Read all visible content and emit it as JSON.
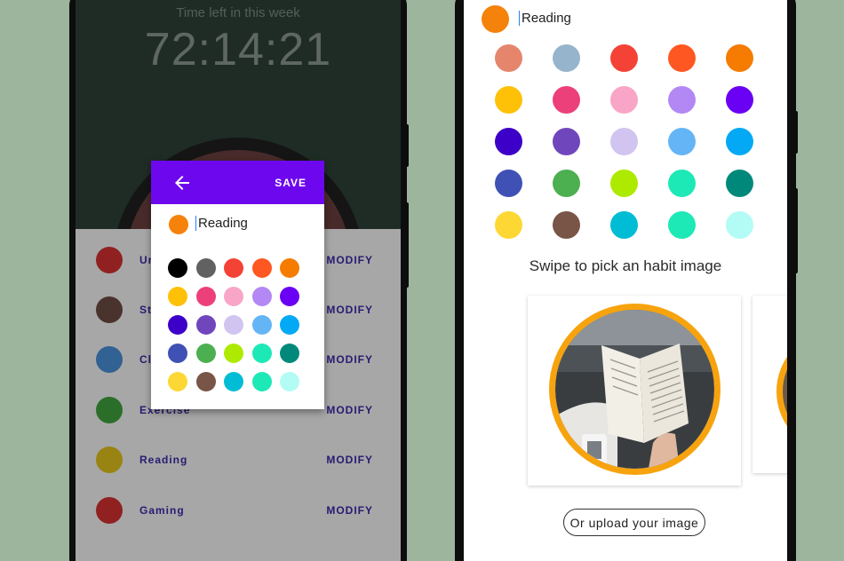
{
  "left_screen": {
    "timer_caption": "Time left in this week",
    "timer_value": "72:14:21",
    "habits": [
      {
        "name": "Ur",
        "color": "#d63232"
      },
      {
        "name": "St",
        "color": "#6d4c41"
      },
      {
        "name": "Cl",
        "color": "#4a90d9"
      },
      {
        "name": "Exercise",
        "color": "#3fa33f"
      },
      {
        "name": "Reading",
        "color": "#e2c31c"
      },
      {
        "name": "Gaming",
        "color": "#d63232"
      }
    ],
    "modify_label": "MODIFY",
    "dialog": {
      "save_label": "SAVE",
      "back_icon": "arrow-back-icon",
      "habit_name": "Reading",
      "selected_color": "#f5820a",
      "palette": [
        "#000000",
        "#616161",
        "#f44336",
        "#ff5722",
        "#f57c00",
        "#ffc107",
        "#ec407a",
        "#f8a5c8",
        "#b388f5",
        "#6a00f4",
        "#3d00c8",
        "#7046bd",
        "#d1c4f0",
        "#64b5f6",
        "#03a9f4",
        "#3f51b5",
        "#4caf50",
        "#aeea00",
        "#1de9b6",
        "#00897b",
        "#fdd835",
        "#795548",
        "#00bcd4",
        "#1de9b6",
        "#b2fcf5"
      ]
    }
  },
  "right_screen": {
    "habit_name": "Reading",
    "selected_color": "#f5820a",
    "palette": [
      "#e5866c",
      "#96b5cc",
      "#f44336",
      "#ff5722",
      "#f57c00",
      "#ffc107",
      "#ec407a",
      "#f8a5c8",
      "#b388f5",
      "#6a00f4",
      "#3d00c8",
      "#7046bd",
      "#d1c4f0",
      "#64b5f6",
      "#03a9f4",
      "#3f51b5",
      "#4caf50",
      "#aeea00",
      "#1de9b6",
      "#00897b",
      "#fdd835",
      "#795548",
      "#00bcd4",
      "#1de9b6",
      "#b2fcf5"
    ],
    "swipe_text": "Swipe to pick an habit image",
    "upload_label": "Or upload your image",
    "image_ring_color": "#f7a30e"
  }
}
